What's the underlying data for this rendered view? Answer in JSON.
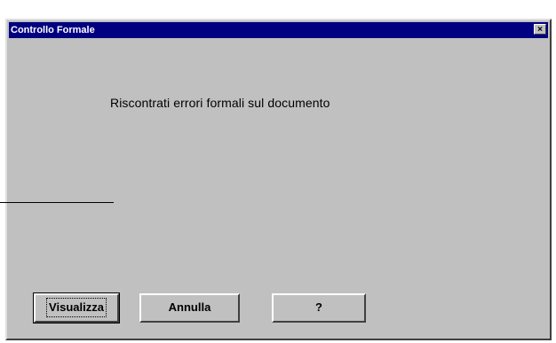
{
  "window": {
    "title": "Controllo Formale",
    "close_label": "×"
  },
  "dialog": {
    "message": "Riscontrati errori formali sul documento"
  },
  "buttons": {
    "visualizza": "Visualizza",
    "annulla": "Annulla",
    "help": "?"
  }
}
